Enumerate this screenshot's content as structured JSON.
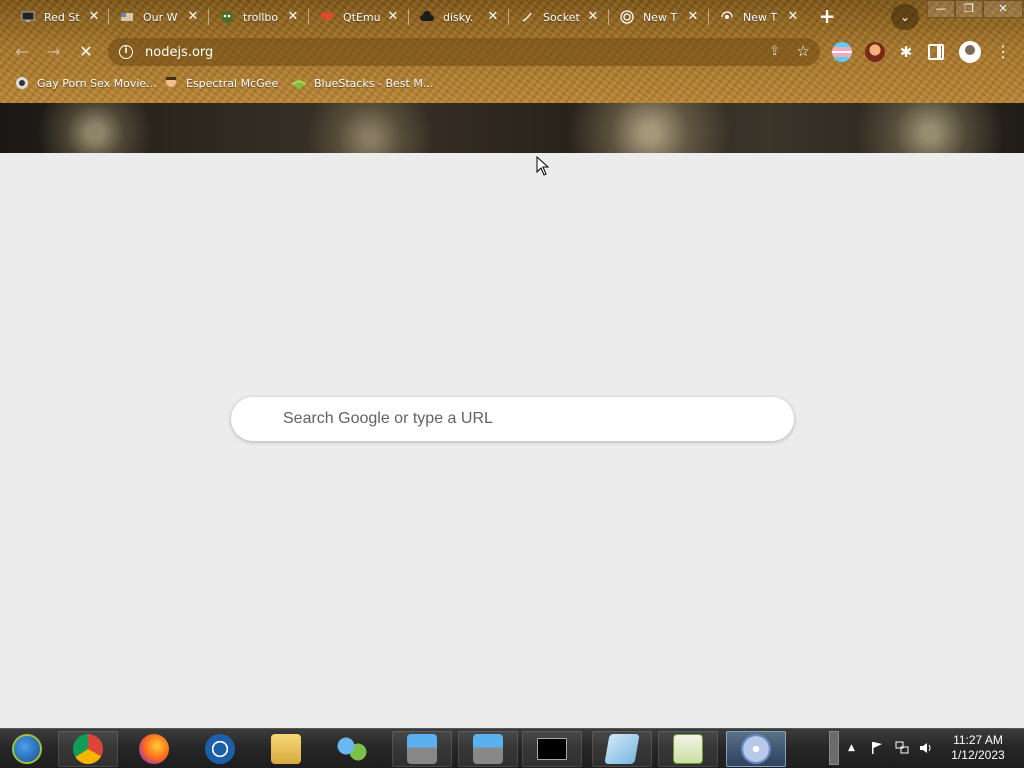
{
  "tabs": [
    {
      "title": "Red St",
      "icon": "monitor-icon",
      "color": "#3a3a3a"
    },
    {
      "title": "Our W",
      "icon": "flag-icon",
      "color": "#d7c8a0"
    },
    {
      "title": "trollbo",
      "icon": "troll-icon",
      "color": "#4a6e2b"
    },
    {
      "title": "QtEmu",
      "icon": "heart-icon",
      "color": "#e04a2a"
    },
    {
      "title": "disky.",
      "icon": "cloud-icon",
      "color": "#1b1b1b"
    },
    {
      "title": "Socket",
      "icon": "socket-icon",
      "color": "#ffffff"
    },
    {
      "title": "New T",
      "icon": "nodejs-icon",
      "color": "#ffffff"
    },
    {
      "title": "New T",
      "icon": "loading-icon",
      "color": "#ffffff"
    }
  ],
  "tab_close_glyph": "✕",
  "window_controls": {
    "minimize": "—",
    "maximize": "❐",
    "close": "✕"
  },
  "toolbar": {
    "url": "nodejs.org",
    "back": "←",
    "forward": "→",
    "reload": "✕",
    "info": "i",
    "share": "⇪",
    "star": "☆",
    "puzzle": "✱",
    "menu": "⋮",
    "new_tab": "+",
    "tab_search": "⌄"
  },
  "bookmarks": [
    {
      "label": "Gay Porn Sex Movie...",
      "icon": "bookmark-favicon-1"
    },
    {
      "label": "Espectral McGee",
      "icon": "bookmark-favicon-2"
    },
    {
      "label": "BlueStacks - Best M...",
      "icon": "bookmark-favicon-3"
    }
  ],
  "search": {
    "placeholder": "Search Google or type a URL"
  },
  "taskbar": {
    "apps": [
      "start-button",
      "chrome",
      "firefox",
      "opera",
      "file-explorer",
      "network-app",
      "installer-1",
      "installer-2",
      "command-prompt",
      "notepad",
      "notepad-plus-plus",
      "disc-app"
    ],
    "tray_arrow": "▲",
    "clock_time": "11:27 AM",
    "clock_date": "1/12/2023"
  }
}
